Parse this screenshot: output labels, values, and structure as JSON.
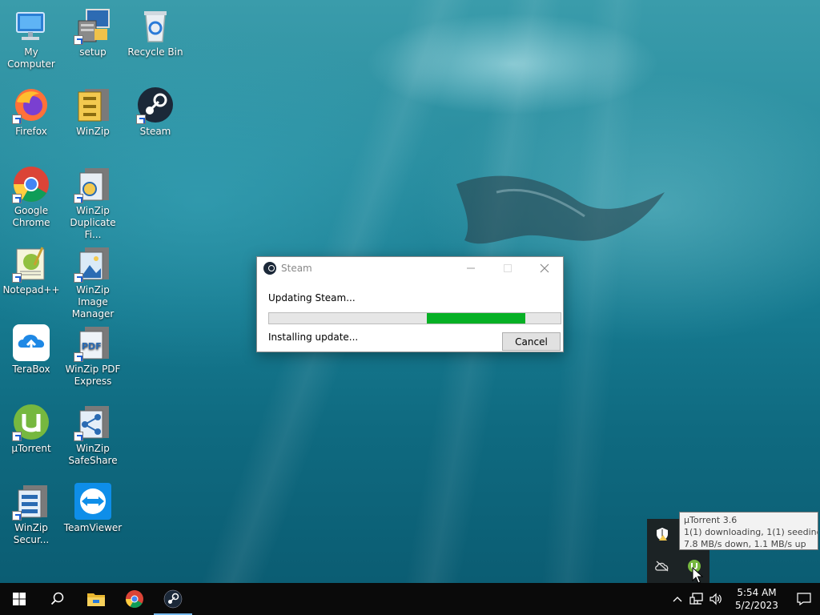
{
  "desktop": {
    "icons": [
      {
        "label": "My Computer",
        "icon": "computer-icon"
      },
      {
        "label": "setup",
        "icon": "setup-icon"
      },
      {
        "label": "Recycle Bin",
        "icon": "recycle-bin-icon"
      },
      {
        "label": "Firefox",
        "icon": "firefox-icon"
      },
      {
        "label": "WinZip",
        "icon": "winzip-icon"
      },
      {
        "label": "Steam",
        "icon": "steam-icon"
      },
      {
        "label": "Google Chrome",
        "icon": "chrome-icon"
      },
      {
        "label": "WinZip Duplicate Fi...",
        "icon": "winzip-duplicate-icon"
      },
      {
        "label": "Notepad++",
        "icon": "notepadpp-icon"
      },
      {
        "label": "WinZip Image Manager",
        "icon": "winzip-image-icon"
      },
      {
        "label": "TeraBox",
        "icon": "terabox-icon"
      },
      {
        "label": "WinZip PDF Express",
        "icon": "winzip-pdf-icon"
      },
      {
        "label": "µTorrent",
        "icon": "utorrent-icon"
      },
      {
        "label": "WinZip SafeShare",
        "icon": "winzip-safeshare-icon"
      },
      {
        "label": "WinZip Secur...",
        "icon": "winzip-secure-icon"
      },
      {
        "label": "TeamViewer",
        "icon": "teamviewer-icon"
      }
    ]
  },
  "dialog": {
    "title": "Steam",
    "message": "Updating Steam...",
    "progress_start_percent": 54,
    "progress_end_percent": 88,
    "status": "Installing update...",
    "cancel_label": "Cancel",
    "progress_color": "#06b025"
  },
  "tooltip": {
    "line1": "µTorrent 3.6",
    "line2": "1(1) downloading, 1(1) seeding",
    "line3": "7.8 MB/s down, 1.1 MB/s up"
  },
  "taskbar": {
    "time": "5:54 AM",
    "date": "5/2/2023",
    "accent": "#76b9ed"
  }
}
